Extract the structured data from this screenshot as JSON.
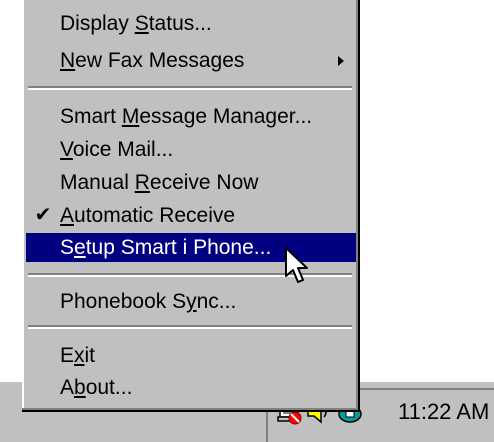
{
  "menu": {
    "items": [
      {
        "pre": "Display ",
        "key": "S",
        "post": "tatus...",
        "checked": false,
        "selected": false,
        "submenu": false
      },
      {
        "pre": "",
        "key": "N",
        "post": "ew Fax Messages",
        "checked": false,
        "selected": false,
        "submenu": true
      },
      {
        "pre": "Smart ",
        "key": "M",
        "post": "essage Manager...",
        "checked": false,
        "selected": false,
        "submenu": false
      },
      {
        "pre": "",
        "key": "V",
        "post": "oice Mail...",
        "checked": false,
        "selected": false,
        "submenu": false
      },
      {
        "pre": "Manual ",
        "key": "R",
        "post": "eceive Now",
        "checked": false,
        "selected": false,
        "submenu": false
      },
      {
        "pre": "",
        "key": "A",
        "post": "utomatic Receive",
        "checked": true,
        "selected": false,
        "submenu": false
      },
      {
        "pre": "S",
        "key": "e",
        "post": "tup Smart i Phone...",
        "checked": false,
        "selected": true,
        "submenu": false
      },
      {
        "pre": "Phonebook S",
        "key": "y",
        "post": "nc...",
        "checked": false,
        "selected": false,
        "submenu": false
      },
      {
        "pre": "E",
        "key": "x",
        "post": "it",
        "checked": false,
        "selected": false,
        "submenu": false
      },
      {
        "pre": "A",
        "key": "b",
        "post": "out...",
        "checked": false,
        "selected": false,
        "submenu": false
      }
    ],
    "check_glyph": "✔"
  },
  "taskbar": {
    "clock": "11:22 AM",
    "tray_icons": [
      "fax-monitor-icon",
      "speaker-icon",
      "phone-icon"
    ]
  },
  "colors": {
    "menu_bg": "#c0c0c0",
    "highlight": "#000080",
    "highlight_text": "#ffffff"
  }
}
